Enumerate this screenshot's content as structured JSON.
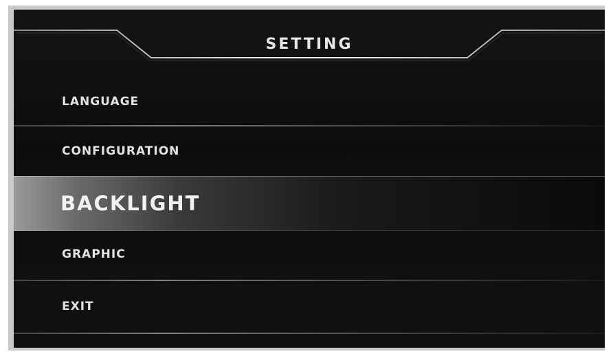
{
  "menu": {
    "title": "SETTING",
    "items": [
      {
        "label": "LANGUAGE",
        "selected": false
      },
      {
        "label": "CONFIGURATION",
        "selected": false
      },
      {
        "label": "BACKLIGHT",
        "selected": true
      },
      {
        "label": "GRAPHIC",
        "selected": false
      },
      {
        "label": "EXIT",
        "selected": false
      }
    ]
  },
  "colors": {
    "background": "#111111",
    "text": "#e3e3e3",
    "selection": "#9a9a9a"
  }
}
